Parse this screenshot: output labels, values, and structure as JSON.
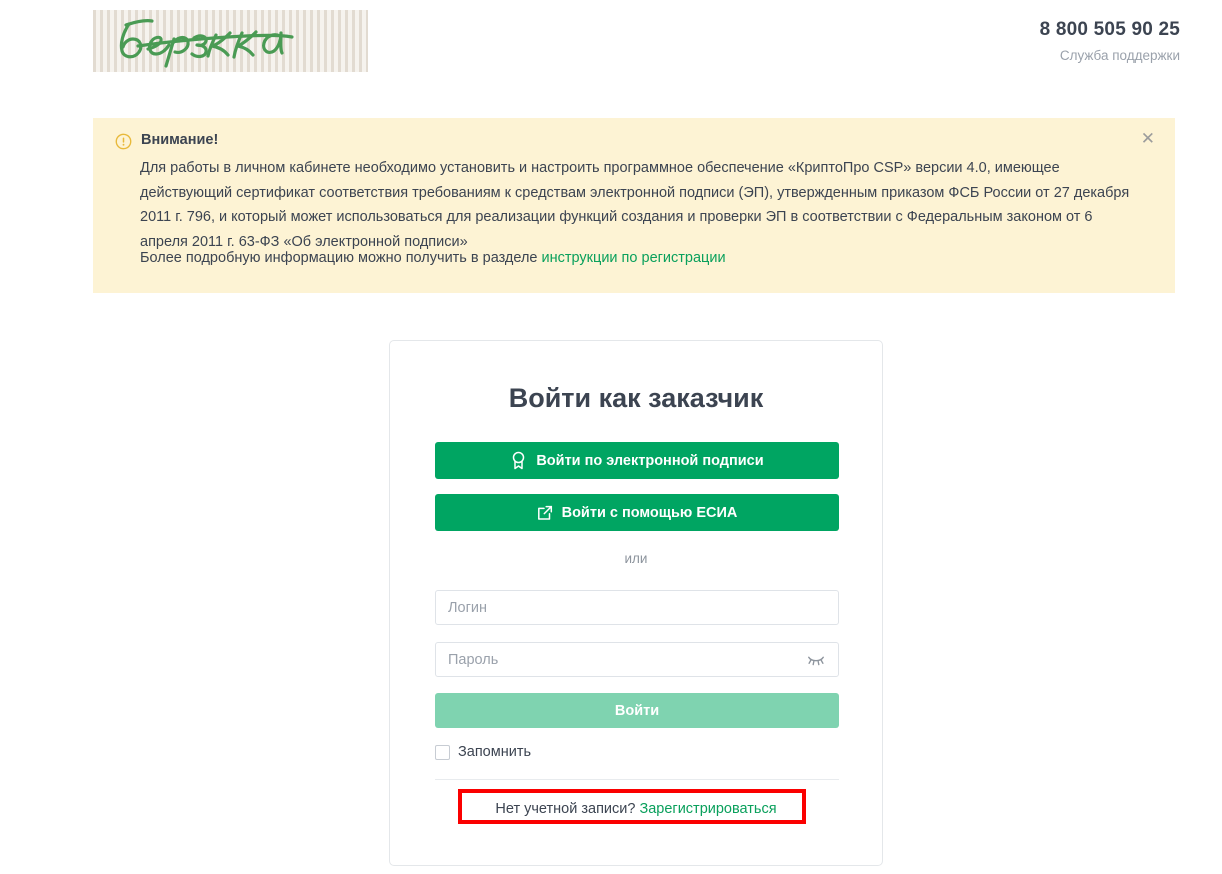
{
  "header": {
    "logo_text": "берёзка",
    "logo_name": "berezka-logo",
    "phone": "8 800 505 90 25",
    "support_label": "Служба поддержки"
  },
  "alert": {
    "icon": "warning-circle-icon",
    "close_icon": "close-icon",
    "title": "Внимание!",
    "body": "Для работы в личном кабинете необходимо установить и настроить программное обеспечение «КриптоПро CSP» версии 4.0, имеющее действующий сертификат соответствия требованиям к средствам электронной подписи (ЭП), утвержденным приказом ФСБ России от 27 декабря 2011 г. 796, и который может использоваться для реализации функций создания и проверки ЭП в соответствии с Федеральным законом от 6 апреля 2011 г. 63-ФЗ «Об электронной подписи»",
    "more_prefix": "Более подробную информацию можно получить в разделе ",
    "more_link": "инструкции по регистрации",
    "bg_color": "#fdf3d4",
    "link_color": "#0aa05c"
  },
  "login_card": {
    "title": "Войти как заказчик",
    "esign_button": {
      "label": "Войти по электронной подписи",
      "icon": "certificate-seal-icon",
      "color": "#00a562"
    },
    "esia_button": {
      "label": "Войти с помощью ЕСИА",
      "icon": "external-link-icon",
      "color": "#00a562"
    },
    "or_label": "или",
    "login_field": {
      "placeholder": "Логин",
      "value": ""
    },
    "password_field": {
      "placeholder": "Пароль",
      "value": "",
      "toggle_icon": "eye-off-icon"
    },
    "submit_button": {
      "label": "Войти",
      "color": "#7fd3b0"
    },
    "remember": {
      "label": "Запомнить",
      "checked": false
    },
    "register": {
      "question": "Нет учетной записи?",
      "link": "Зарегистрироваться"
    }
  },
  "annotation": {
    "color": "#fb0000",
    "target": "register-row"
  }
}
